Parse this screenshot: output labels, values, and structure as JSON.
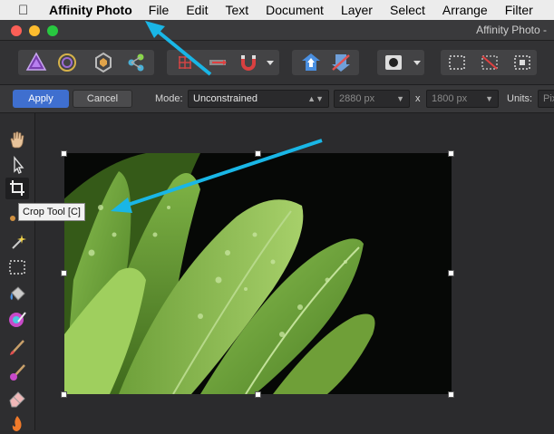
{
  "menubar": {
    "app_name": "Affinity Photo",
    "items": [
      "File",
      "Edit",
      "Text",
      "Document",
      "Layer",
      "Select",
      "Arrange",
      "Filter"
    ]
  },
  "window": {
    "title": "Affinity Photo -"
  },
  "toolbar": {
    "personas": [
      "photo-persona-icon",
      "liquify-persona-icon",
      "develop-persona-icon",
      "export-persona-icon"
    ]
  },
  "context_toolbar": {
    "apply_label": "Apply",
    "cancel_label": "Cancel",
    "mode_label": "Mode:",
    "mode_value": "Unconstrained",
    "width_value": "2880 px",
    "x_label": "x",
    "height_value": "1800 px",
    "units_label": "Units:",
    "units_value": "Pix"
  },
  "tooltip": {
    "text": "Crop Tool [C]"
  },
  "colors": {
    "accent_blue": "#3f6fcf",
    "annotation_arrow": "#19b6e6",
    "leaf_green": "#6fa83a"
  }
}
